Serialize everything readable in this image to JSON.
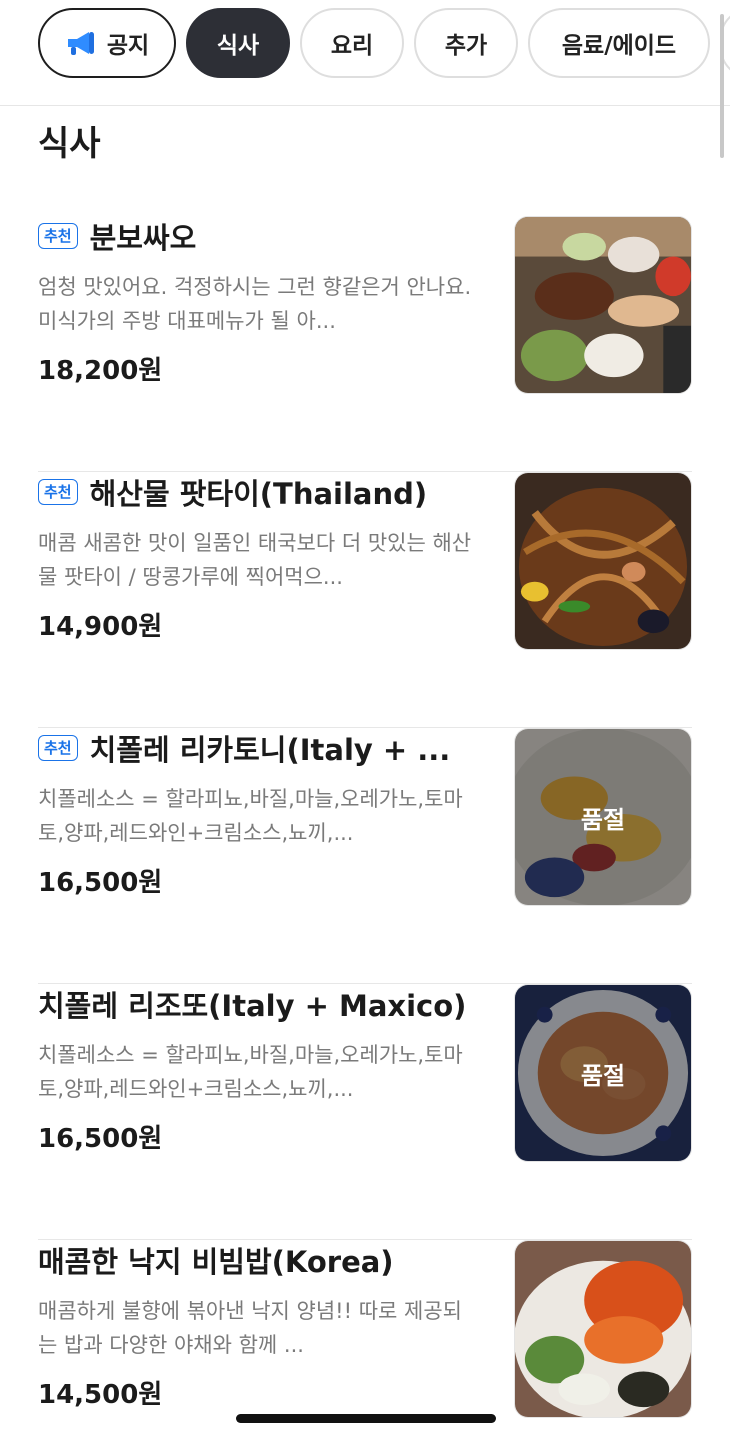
{
  "tabs": [
    {
      "label": "공지",
      "icon": "megaphone-icon"
    },
    {
      "label": "식사"
    },
    {
      "label": "요리"
    },
    {
      "label": "추가"
    },
    {
      "label": "음료/에이드"
    },
    {
      "label": ""
    }
  ],
  "section": {
    "title": "식사"
  },
  "items": [
    {
      "badge": "추천",
      "name": "분보싸오",
      "desc": "엄청 맛있어요. 걱정하시는 그런 향같은거 안나요. 미식가의 주방 대표메뉴가 될 아...",
      "price": "18,200원",
      "status": ""
    },
    {
      "badge": "추천",
      "name": "해산물 팟타이(Thailand)",
      "desc": "매콤 새콤한 맛이 일품인 태국보다 더 맛있는 해산물 팟타이 / 땅콩가루에 찍어먹으...",
      "price": "14,900원",
      "status": ""
    },
    {
      "badge": "추천",
      "name": "치폴레 리카토니(Italy + ...",
      "desc": "치폴레소스 = 할라피뇨,바질,마늘,오레가노,토마토,양파,레드와인+크림소스,뇨끼,...",
      "price": "16,500원",
      "status": "품절"
    },
    {
      "badge": "",
      "name": "치폴레 리조또(Italy + Maxico)",
      "desc": "치폴레소스 = 할라피뇨,바질,마늘,오레가노,토마토,양파,레드와인+크림소스,뇨끼,...",
      "price": "16,500원",
      "status": "품절"
    },
    {
      "badge": "",
      "name": "매콤한 낙지 비빔밥(Korea)",
      "desc": "매콤하게 불향에 볶아낸 낙지 양념!! 따로 제공되는 밥과 다양한 야채와 함께 ...",
      "price": "14,500원",
      "status": ""
    }
  ],
  "colors": {
    "accent": "#1a73e8",
    "active_tab": "#2d2f36"
  }
}
